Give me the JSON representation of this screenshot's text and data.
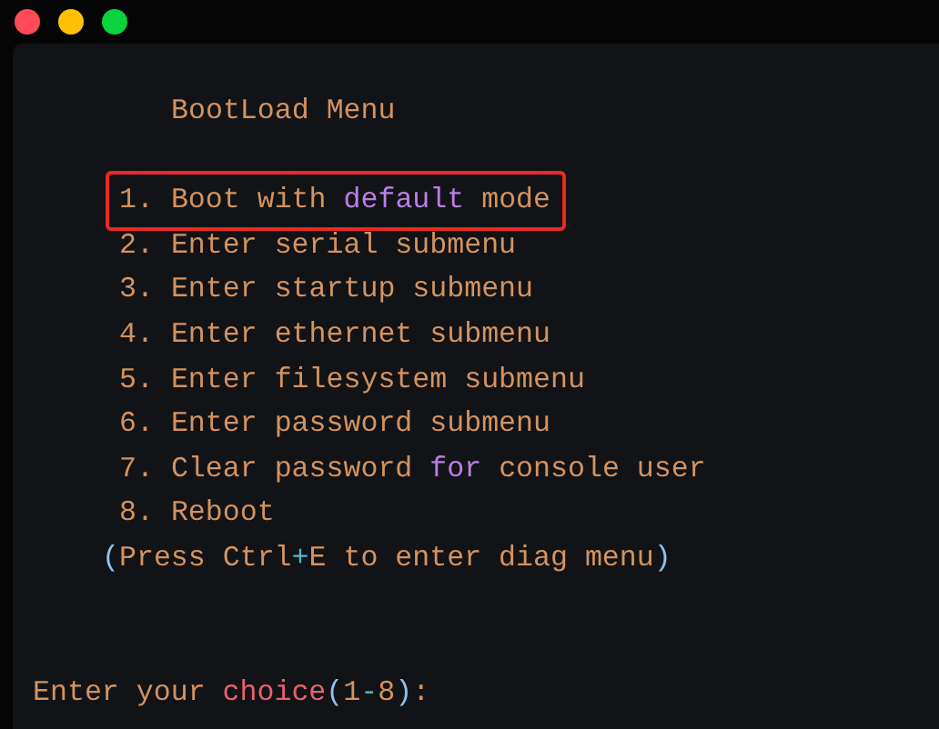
{
  "lines": [
    {
      "kind": "title",
      "segments": [
        {
          "text": "BootLoad Menu",
          "kind": "plain"
        }
      ]
    },
    {
      "kind": "blank"
    },
    {
      "kind": "item",
      "highlighted": true,
      "segments": [
        {
          "text": "1. Boot with ",
          "kind": "plain"
        },
        {
          "text": "default",
          "kind": "keyword"
        },
        {
          "text": " mode",
          "kind": "plain"
        }
      ]
    },
    {
      "kind": "item",
      "highlighted": false,
      "segments": [
        {
          "text": "2. Enter serial submenu",
          "kind": "plain"
        }
      ]
    },
    {
      "kind": "item",
      "highlighted": false,
      "segments": [
        {
          "text": "3. Enter startup submenu",
          "kind": "plain"
        }
      ]
    },
    {
      "kind": "item",
      "highlighted": false,
      "segments": [
        {
          "text": "4. Enter ethernet submenu",
          "kind": "plain"
        }
      ]
    },
    {
      "kind": "item",
      "highlighted": false,
      "segments": [
        {
          "text": "5. Enter filesystem submenu",
          "kind": "plain"
        }
      ]
    },
    {
      "kind": "item",
      "highlighted": false,
      "segments": [
        {
          "text": "6. Enter password submenu",
          "kind": "plain"
        }
      ]
    },
    {
      "kind": "item",
      "highlighted": false,
      "segments": [
        {
          "text": "7. Clear password ",
          "kind": "plain"
        },
        {
          "text": "for",
          "kind": "keyword"
        },
        {
          "text": " console user",
          "kind": "plain"
        }
      ]
    },
    {
      "kind": "item",
      "highlighted": false,
      "segments": [
        {
          "text": "8. Reboot",
          "kind": "plain"
        }
      ]
    },
    {
      "kind": "note",
      "segments": [
        {
          "text": "(",
          "kind": "paren"
        },
        {
          "text": "Press Ctrl",
          "kind": "plain"
        },
        {
          "text": "+",
          "kind": "operator"
        },
        {
          "text": "E to enter diag menu",
          "kind": "plain"
        },
        {
          "text": ")",
          "kind": "paren"
        }
      ]
    },
    {
      "kind": "blank"
    },
    {
      "kind": "blank"
    },
    {
      "kind": "prompt",
      "segments": [
        {
          "text": "Enter your ",
          "kind": "plain"
        },
        {
          "text": "choice",
          "kind": "function"
        },
        {
          "text": "(",
          "kind": "paren"
        },
        {
          "text": "1",
          "kind": "plain"
        },
        {
          "text": "-",
          "kind": "operator"
        },
        {
          "text": "8",
          "kind": "plain"
        },
        {
          "text": ")",
          "kind": "paren"
        },
        {
          "text": ":",
          "kind": "plain"
        }
      ]
    }
  ]
}
